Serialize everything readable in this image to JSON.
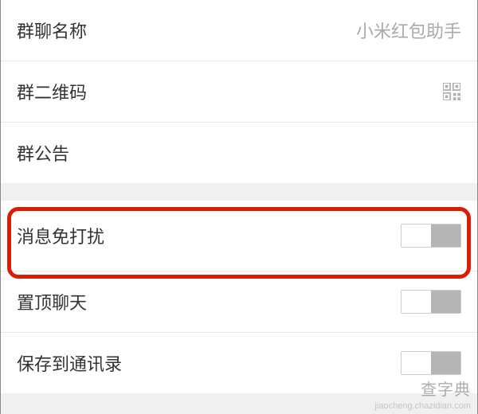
{
  "section1": {
    "groupName": {
      "label": "群聊名称",
      "value": "小米红包助手"
    },
    "qrCode": {
      "label": "群二维码"
    },
    "announcement": {
      "label": "群公告"
    }
  },
  "section2": {
    "muteNotifications": {
      "label": "消息免打扰"
    },
    "pinChat": {
      "label": "置顶聊天"
    },
    "saveContacts": {
      "label": "保存到通讯录"
    }
  },
  "watermark": {
    "main": "查字典",
    "sub": "jiaocheng.chazidian.com"
  }
}
